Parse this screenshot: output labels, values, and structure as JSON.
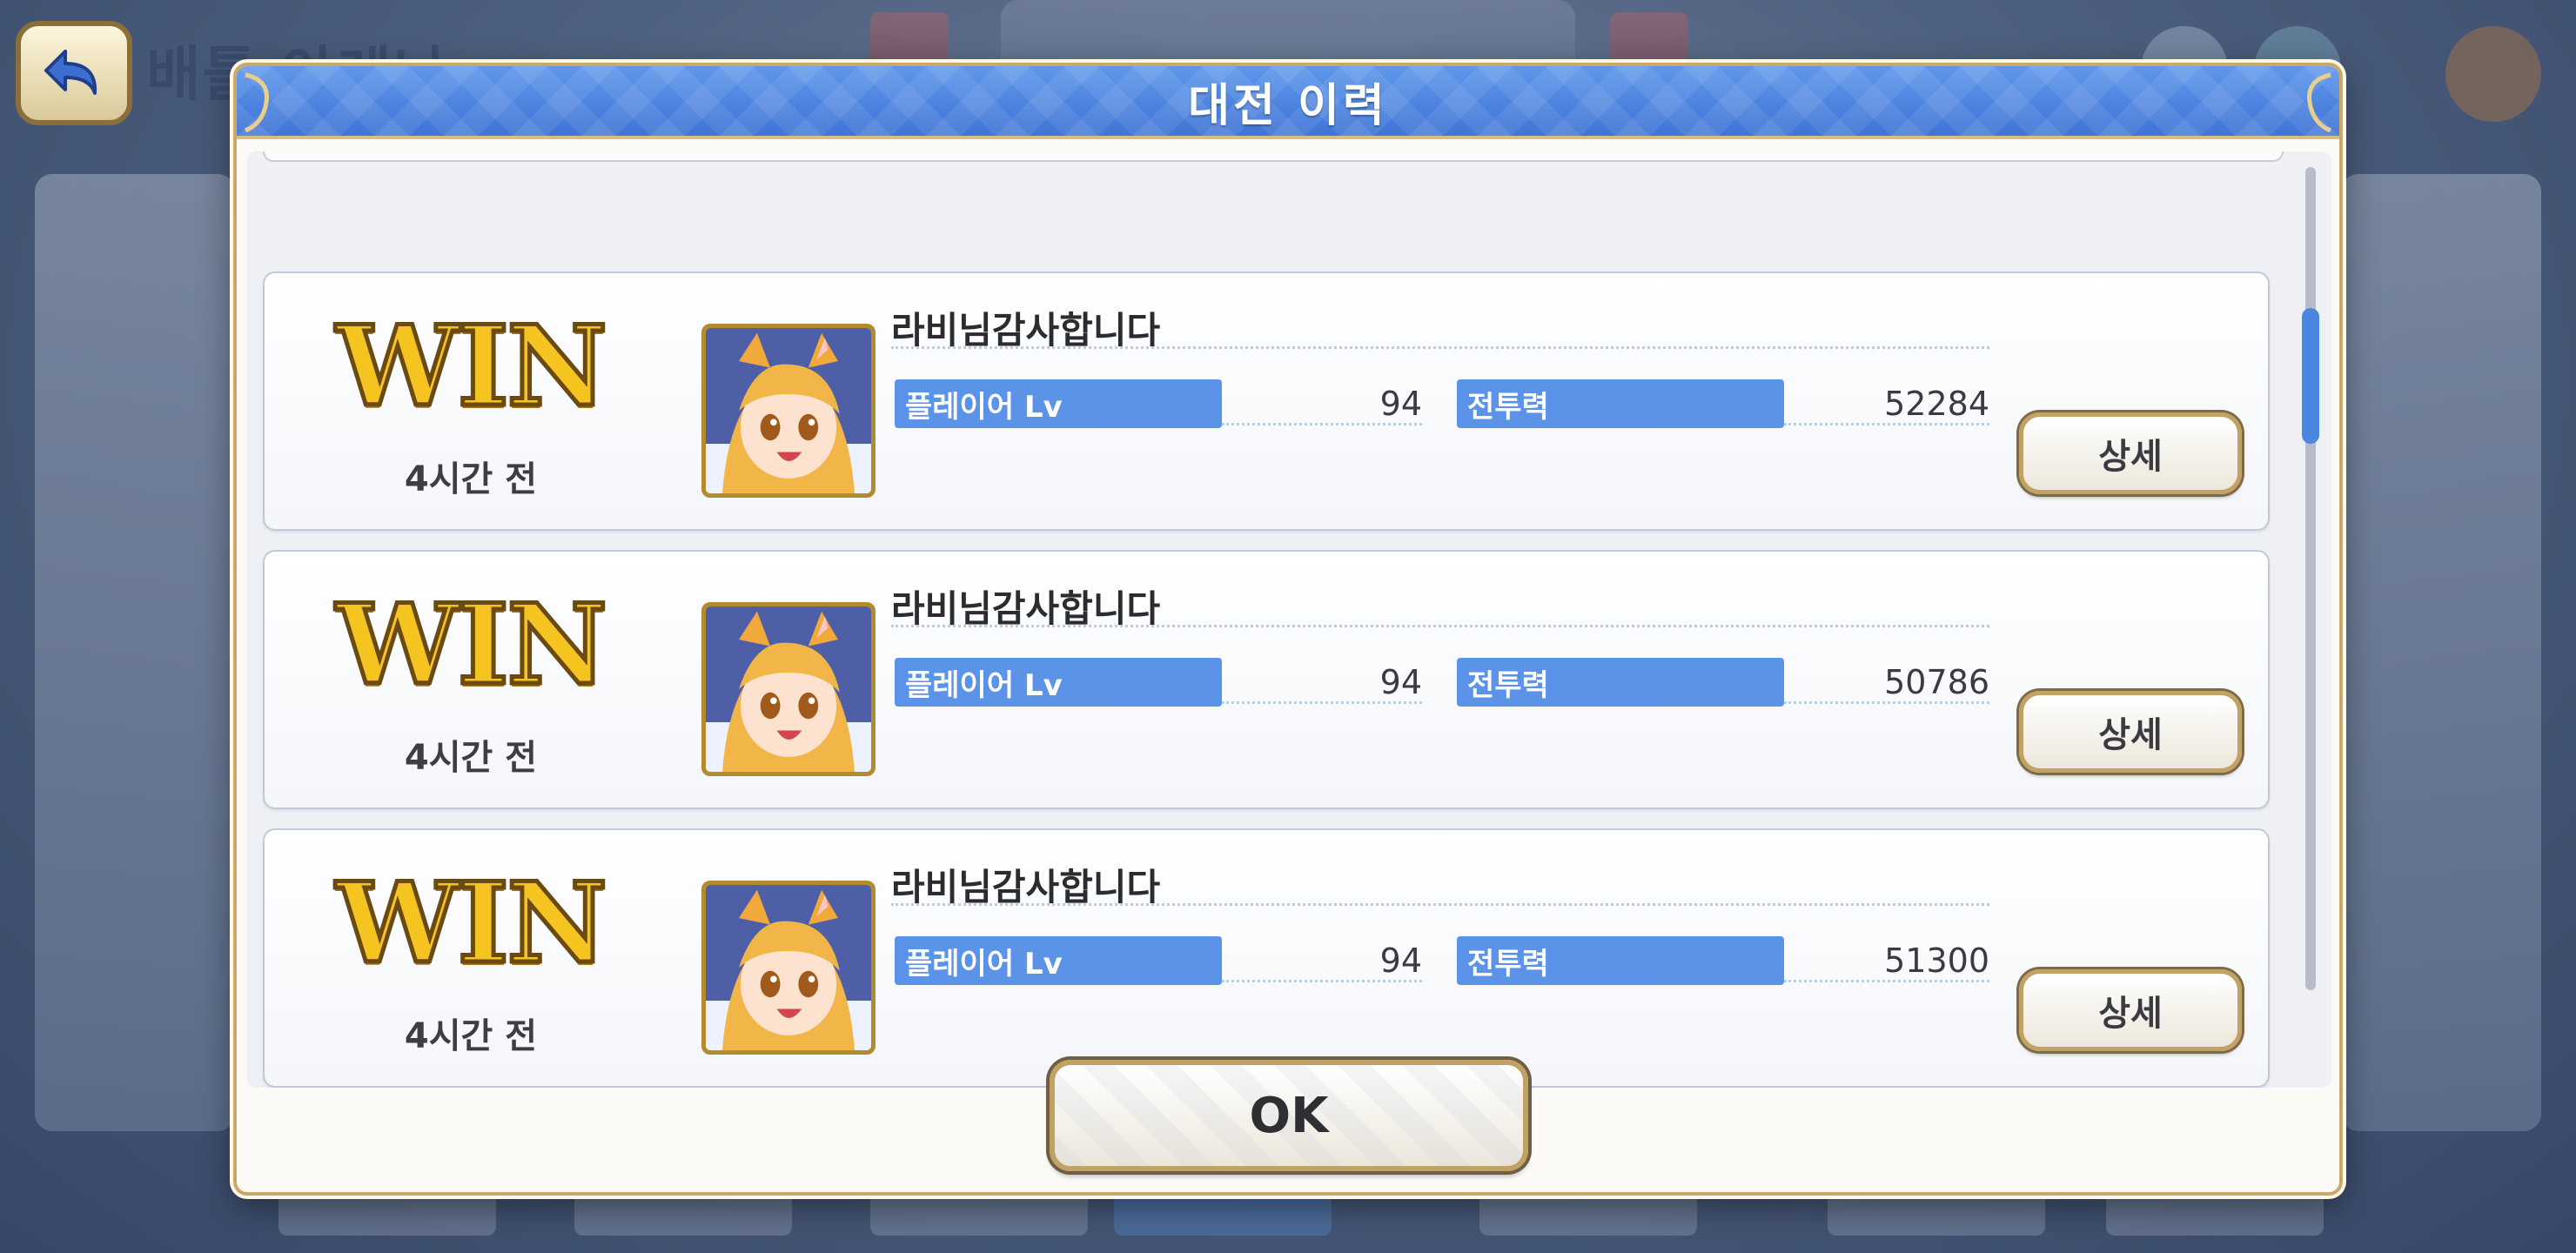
{
  "background": {
    "screen_title": "배틀 아레나"
  },
  "dialog": {
    "title": "대전 이력",
    "ok_label": "OK"
  },
  "records": [
    {
      "result": "WIN",
      "time_ago": "4시간 전",
      "player_name": "라비님감사합니다",
      "level_label": "플레이어 Lv",
      "level": "94",
      "power_label": "전투력",
      "power": "52284",
      "detail_label": "상세"
    },
    {
      "result": "WIN",
      "time_ago": "4시간 전",
      "player_name": "라비님감사합니다",
      "level_label": "플레이어 Lv",
      "level": "94",
      "power_label": "전투력",
      "power": "50786",
      "detail_label": "상세"
    },
    {
      "result": "WIN",
      "time_ago": "4시간 전",
      "player_name": "라비님감사합니다",
      "level_label": "플레이어 Lv",
      "level": "94",
      "power_label": "전투력",
      "power": "51300",
      "detail_label": "상세"
    }
  ],
  "colors": {
    "header_blue": "#4a82dd",
    "stat_label_blue": "#5a93e7",
    "win_gold": "#f5c420",
    "frame_gold": "#c9a86a",
    "scroll_thumb": "#4b86e3"
  },
  "icons": {
    "back": "back-arrow-icon",
    "avatar": "character-portrait"
  }
}
